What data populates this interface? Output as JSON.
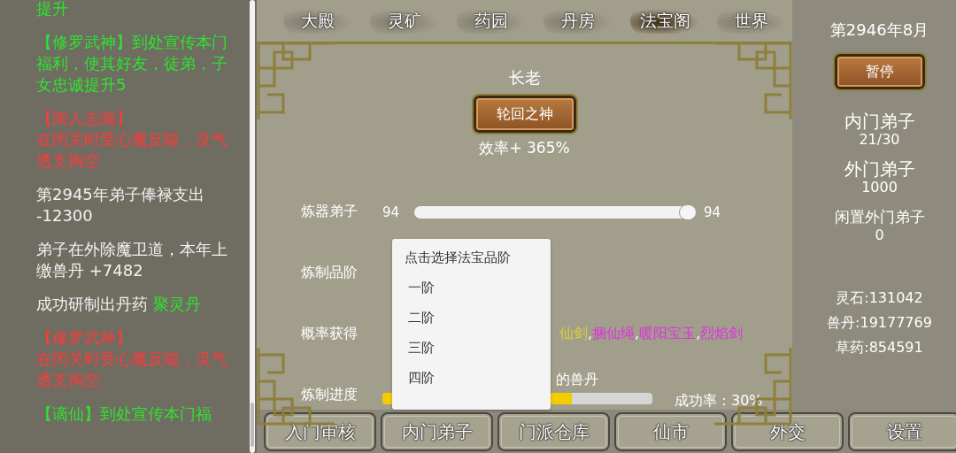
{
  "log": [
    {
      "kind": "good",
      "text": "提升"
    },
    {
      "kind": "good",
      "name": "【修罗武神】",
      "text": "到处宣传本门福利，使其好友，徒弟，子女忠诚提升5"
    },
    {
      "kind": "bad",
      "name": "【闻人志瀚】",
      "text": "在闭关时受心魔反噬，灵气透支掏空"
    },
    {
      "kind": "info",
      "text": "第2945年弟子俸禄支出 -12300"
    },
    {
      "kind": "info",
      "text": "弟子在外除魔卫道，本年上缴兽丹 +7482"
    },
    {
      "kind": "craft",
      "name": "聚灵丹",
      "text": "成功研制出丹药 "
    },
    {
      "kind": "bad",
      "name": "【修罗武神】",
      "text": "在闭关时受心魔反噬，灵气透支掏空"
    },
    {
      "kind": "good",
      "name": "【谪仙】",
      "text": "到处宣传本门福"
    }
  ],
  "tabs": [
    {
      "label": "大殿",
      "selected": false
    },
    {
      "label": "灵矿",
      "selected": false
    },
    {
      "label": "药园",
      "selected": false
    },
    {
      "label": "丹房",
      "selected": false
    },
    {
      "label": "法宝阁",
      "selected": true
    },
    {
      "label": "世界",
      "selected": false
    }
  ],
  "elder": {
    "title": "长老",
    "name": "轮回之神",
    "efficiency": "效率+ 365%"
  },
  "workers": {
    "label": "炼器弟子",
    "value": "94",
    "level": 1,
    "max": "94"
  },
  "grade": {
    "label": "炼制品阶"
  },
  "chance": {
    "label": "概率获得",
    "separator": ",",
    "items": [
      {
        "text": "仙剑",
        "color": "#d8d23a"
      },
      {
        "text": "捆仙绳",
        "color": "#e030e0"
      },
      {
        "text": "暖阳宝玉",
        "color": "#e030e0"
      },
      {
        "text": "烈焰剑",
        "color": "#e030e0"
      }
    ]
  },
  "progress": {
    "label": "炼制进度",
    "caption": "的兽丹",
    "level": 0.7,
    "rate": "成功率：30%"
  },
  "dropdown": {
    "header": "点击选择法宝品阶",
    "options": [
      {
        "label": "一阶",
        "selected": false
      },
      {
        "label": "二阶",
        "selected": false
      },
      {
        "label": "三阶",
        "selected": false
      },
      {
        "label": "四阶",
        "selected": false
      }
    ]
  },
  "status": {
    "date": "第2946年8月",
    "pause": "暂停",
    "stats": [
      {
        "label": "内门弟子",
        "value": "21/30"
      },
      {
        "label": "外门弟子",
        "value": "1000"
      },
      {
        "label": "闲置外门弟子",
        "value": "0"
      }
    ],
    "resources": [
      "灵石:131042",
      "兽丹:19177769",
      "草药:854591"
    ]
  },
  "bottom_buttons": [
    "入门审核",
    "内门弟子",
    "门派仓库",
    "仙市",
    "外交",
    "设置"
  ]
}
